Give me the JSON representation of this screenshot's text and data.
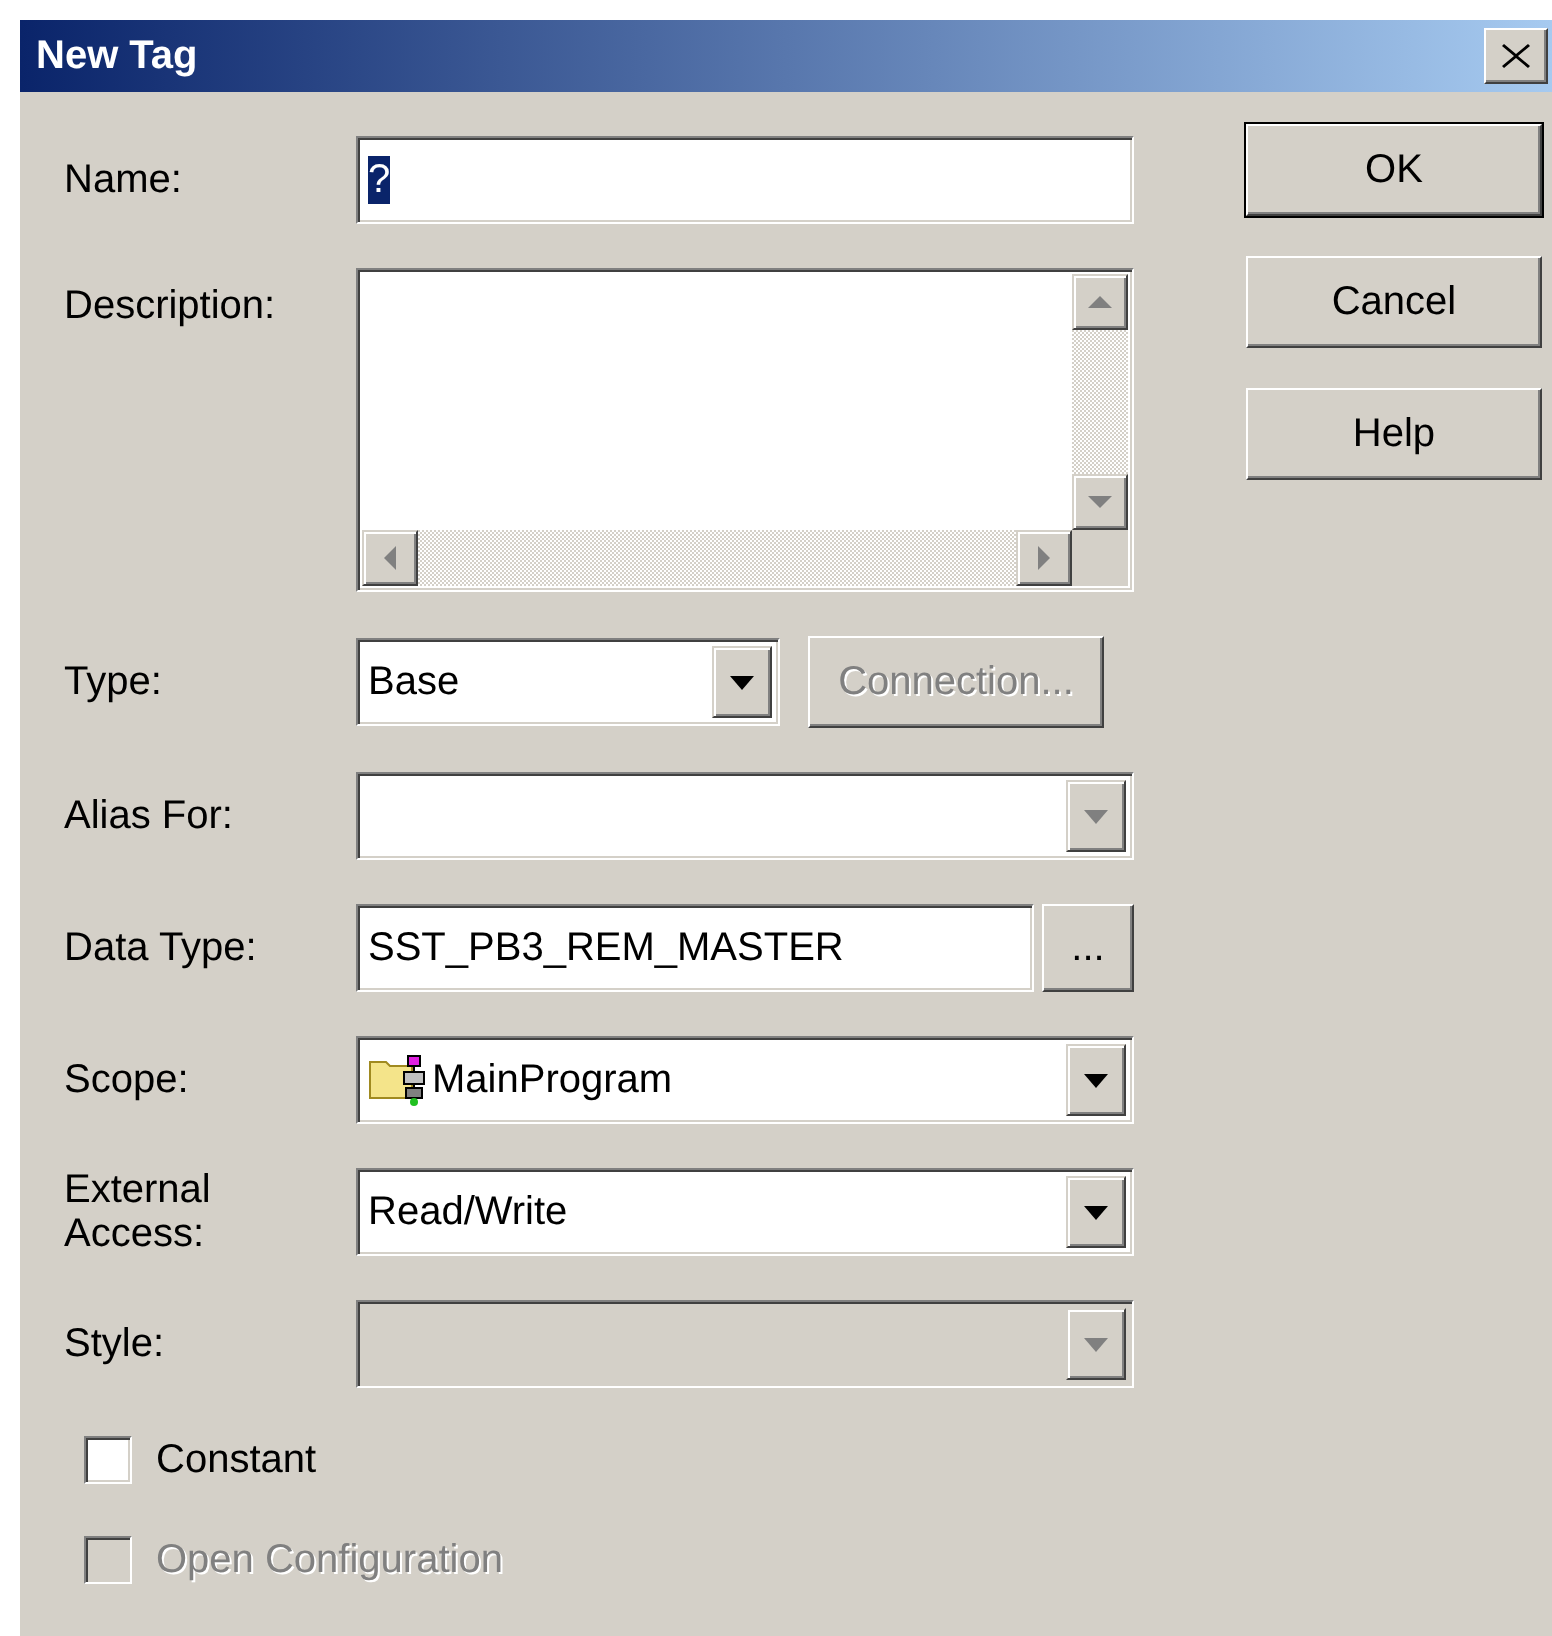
{
  "window": {
    "title": "New Tag"
  },
  "fields": [
    {
      "kind": "text",
      "label": "Name:",
      "value": "?",
      "value_selected": true
    },
    {
      "kind": "memo",
      "label": "Description:"
    },
    {
      "kind": "dropdown",
      "label": "Type:",
      "value": "Base",
      "disabled": false,
      "button": {
        "label": "Connection...",
        "disabled": true
      }
    },
    {
      "kind": "combo",
      "label": "Alias For:",
      "disabled": true
    },
    {
      "kind": "browse",
      "label": "Data Type:",
      "value": "SST_PB3_REM_MASTER",
      "button": {
        "label": "...",
        "disabled": false
      }
    },
    {
      "kind": "dropdown",
      "label": "Scope:",
      "value": "MainProgram",
      "icon": true,
      "disabled": false
    },
    {
      "kind": "dropdown",
      "label": "External Access:",
      "value": "Read/Write",
      "disabled": false
    },
    {
      "kind": "dropdown",
      "label": "Style:",
      "disabled": true
    }
  ],
  "checkboxes": [
    {
      "label": "Constant",
      "checked": false,
      "disabled": false
    },
    {
      "label": "Open Configuration",
      "checked": false,
      "disabled": true
    }
  ],
  "buttons": [
    {
      "label": "OK",
      "default": true
    },
    {
      "label": "Cancel",
      "default": false
    },
    {
      "label": "Help",
      "default": false
    }
  ]
}
